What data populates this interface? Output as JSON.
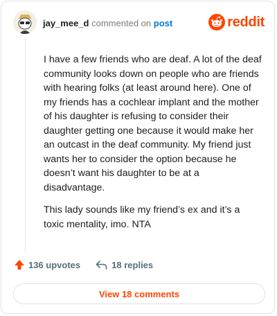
{
  "header": {
    "username": "jay_mee_d",
    "commented_on": "commented on",
    "post_link": "post",
    "brand": "reddit"
  },
  "comment": {
    "paragraphs": [
      "I have a few friends who are deaf. A lot of the deaf community looks down on people who are friends with hearing folks (at least around here). One of my friends has a cochlear implant and the mother of his daughter is refusing to consider their daughter getting one because it would make her an outcast in the deaf community. My friend just wants her to consider the option because he doesn’t want his daughter to be at a disadvantage.",
      "This lady sounds like my friend’s ex and it’s a toxic mentality, imo. NTA"
    ]
  },
  "actions": {
    "upvotes": "136 upvotes",
    "replies": "18 replies",
    "view_comments": "View 18 comments"
  },
  "colors": {
    "brand_orange": "#ff4500",
    "link_blue": "#0079d3",
    "muted_text": "#576f76"
  },
  "icons": {
    "avatar": "snoo-avatar",
    "upvote": "upvote-arrow-icon",
    "reply": "reply-arrow-icon",
    "brand": "reddit-logo-icon"
  }
}
